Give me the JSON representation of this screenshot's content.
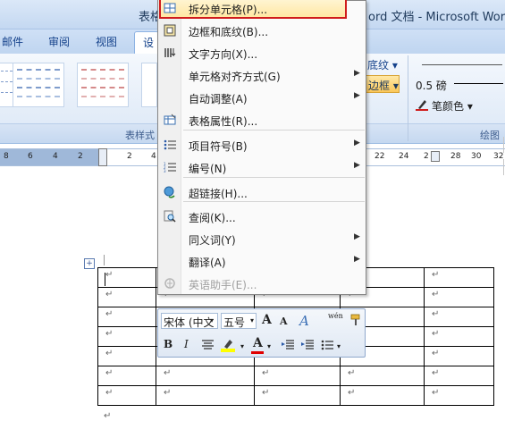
{
  "window": {
    "title_left": "表格",
    "title_right": "ord 文档 - Microsoft Word"
  },
  "ribbon": {
    "tabs": [
      "邮件",
      "审阅",
      "视图",
      "设"
    ],
    "group_table_styles": "表样式",
    "group_draw_borders": "绘图",
    "shading_label": "底纹 ▾",
    "border_label": "边框 ▾",
    "pen_weight": "0.5 磅",
    "pen_color": "笔颜色 ▾"
  },
  "ruler": {
    "left_numbers": [
      "8",
      "6",
      "4",
      "2"
    ],
    "right_numbers": [
      "2",
      "4",
      "22",
      "24",
      "2",
      "28",
      "30",
      "32"
    ]
  },
  "context_menu": {
    "items": [
      {
        "label": "拆分单元格(P)...",
        "icon": "split-cells-icon",
        "submenu": false,
        "highlighted": true
      },
      {
        "label": "边框和底纹(B)...",
        "icon": "borders-shading-icon",
        "submenu": false
      },
      {
        "label": "文字方向(X)...",
        "icon": "text-direction-icon",
        "submenu": false
      },
      {
        "label": "单元格对齐方式(G)",
        "icon": "",
        "submenu": true
      },
      {
        "label": "自动调整(A)",
        "icon": "",
        "submenu": true
      },
      {
        "label": "表格属性(R)...",
        "icon": "table-properties-icon",
        "submenu": false
      },
      {
        "label": "项目符号(B)",
        "icon": "bullets-icon",
        "submenu": true
      },
      {
        "label": "编号(N)",
        "icon": "numbering-icon",
        "submenu": true
      },
      {
        "label": "超链接(H)...",
        "icon": "hyperlink-icon",
        "submenu": false
      },
      {
        "label": "查阅(K)...",
        "icon": "lookup-icon",
        "submenu": false
      },
      {
        "label": "同义词(Y)",
        "icon": "",
        "submenu": true
      },
      {
        "label": "翻译(A)",
        "icon": "",
        "submenu": true
      },
      {
        "label": "英语助手(E)...",
        "icon": "english-assistant-icon",
        "submenu": false,
        "disabled": true
      }
    ]
  },
  "mini_toolbar": {
    "font_name": "宋体 (中文",
    "font_size": "五号",
    "grow_font": "A",
    "shrink_font": "A",
    "styles": "A",
    "phonetic": "wén",
    "bold": "B",
    "italic": "I",
    "font_color_glyph": "A"
  },
  "document": {
    "paragraph_mark": "↵",
    "table": {
      "rows": 7,
      "cols": 5
    }
  },
  "colors": {
    "highlight_border": "#d01c1c",
    "menu_highlight": "#ffe7a3",
    "ribbon_accent": "#15428b"
  }
}
